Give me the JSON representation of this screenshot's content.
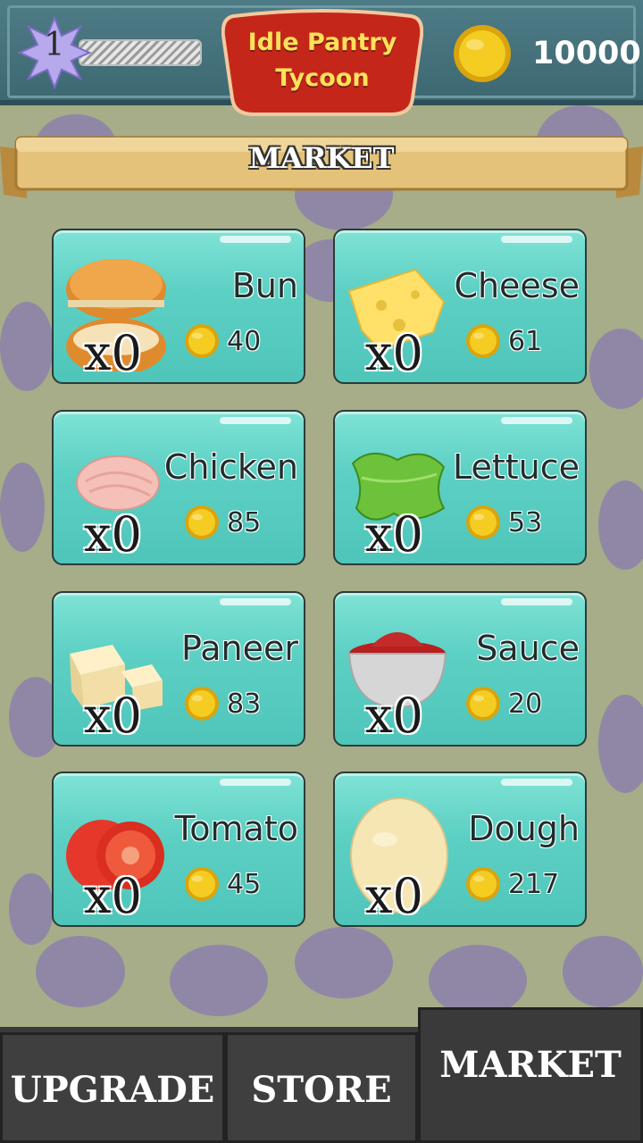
{
  "header": {
    "level": "1",
    "xp_fraction": 0.0,
    "game_title_line1": "Idle Pantry",
    "game_title_line2": "Tycoon",
    "coins": "10000"
  },
  "section_title": "MARKET",
  "items": [
    {
      "name": "Bun",
      "price": "40",
      "qty": "x0",
      "icon": "bun-icon"
    },
    {
      "name": "Cheese",
      "price": "61",
      "qty": "x0",
      "icon": "cheese-icon"
    },
    {
      "name": "Chicken",
      "price": "85",
      "qty": "x0",
      "icon": "chicken-icon"
    },
    {
      "name": "Lettuce",
      "price": "53",
      "qty": "x0",
      "icon": "lettuce-icon"
    },
    {
      "name": "Paneer",
      "price": "83",
      "qty": "x0",
      "icon": "paneer-icon"
    },
    {
      "name": "Sauce",
      "price": "20",
      "qty": "x0",
      "icon": "sauce-icon"
    },
    {
      "name": "Tomato",
      "price": "45",
      "qty": "x0",
      "icon": "tomato-icon"
    },
    {
      "name": "Dough",
      "price": "217",
      "qty": "x0",
      "icon": "dough-icon"
    }
  ],
  "nav": {
    "upgrade": "UPGRADE",
    "store": "STORE",
    "market": "MARKET"
  },
  "colors": {
    "card": "#5dd0c4",
    "coin": "#f2c21a",
    "logo_red": "#c4271a",
    "logo_text": "#ffe15a"
  }
}
